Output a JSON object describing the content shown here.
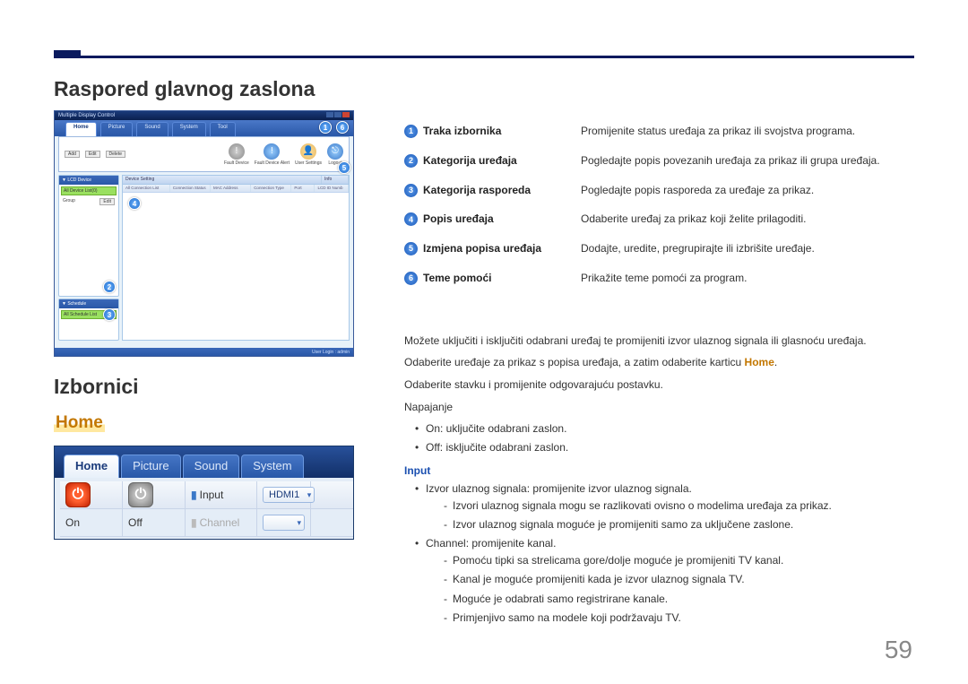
{
  "page_number": "59",
  "headings": {
    "layout": "Raspored glavnog zaslona",
    "menus": "Izbornici",
    "home": "Home"
  },
  "legend": {
    "items": [
      {
        "n": "1",
        "term": "Traka izbornika",
        "desc": "Promijenite status uređaja za prikaz ili svojstva programa."
      },
      {
        "n": "2",
        "term": "Kategorija uređaja",
        "desc": "Pogledajte popis povezanih uređaja za prikaz ili grupa uređaja."
      },
      {
        "n": "3",
        "term": "Kategorija rasporeda",
        "desc": "Pogledajte popis rasporeda za uređaje za prikaz."
      },
      {
        "n": "4",
        "term": "Popis uređaja",
        "desc": "Odaberite uređaj za prikaz koji želite prilagoditi."
      },
      {
        "n": "5",
        "term": "Izmjena popisa uređaja",
        "desc": "Dodajte, uredite, pregrupirajte ili izbrišite uređaje."
      },
      {
        "n": "6",
        "term": "Teme pomoći",
        "desc": "Prikažite teme pomoći za program."
      }
    ]
  },
  "shot1": {
    "title": "Multiple Display Control",
    "menutabs": [
      "Home",
      "Picture",
      "Sound",
      "System",
      "Tool"
    ],
    "toolbar_btns": [
      "Add",
      "Edit",
      "Delete"
    ],
    "toolbar_icons": [
      {
        "label": "Fault Device",
        "icon": "⚠"
      },
      {
        "label": "Fault Device Alert",
        "icon": "⚠"
      },
      {
        "label": "User Settings",
        "icon": "👤"
      },
      {
        "label": "Logout",
        "icon": "⎋"
      }
    ],
    "side_panel1_head": "▼ LCD Device",
    "side_panel1_item": "All Device List(0)",
    "side_panel1_group": "Group",
    "side_panel1_edit": "Edit",
    "side_panel2_head": "▼ Schedule",
    "side_panel2_item": "All Schedule List",
    "grid_cols_top": [
      "Device Setting",
      "Info"
    ],
    "grid_cols": [
      "All Connection List",
      "Connection Status",
      "MAC Address",
      "Connection Type",
      "Port",
      "LCD ID Numb"
    ],
    "status": "User Login : admin"
  },
  "shot2": {
    "tabs": [
      "Home",
      "Picture",
      "Sound",
      "System"
    ],
    "labels": {
      "on": "On",
      "off": "Off",
      "input": "Input",
      "channel": "Channel"
    },
    "dd_value": "HDMI1"
  },
  "right_text": {
    "p1": "Možete uključiti i isključiti odabrani uređaj te promijeniti izvor ulaznog signala ili glasnoću uređaja.",
    "p2_a": "Odaberite uređaje za prikaz s popisa uređaja, a zatim odaberite karticu ",
    "p2_hl": "Home",
    "p2_b": ".",
    "p3": "Odaberite stavku i promijenite odgovarajuću postavku.",
    "p4": "Napajanje",
    "bul1_a": "On",
    "bul1_b": ": uključite odabrani zaslon.",
    "bul2_a": "Off",
    "bul2_b": ": isključite odabrani zaslon.",
    "label_input": "Input",
    "bul3": "Izvor ulaznog signala: promijenite izvor ulaznog signala.",
    "dash3a": "Izvori ulaznog signala mogu se razlikovati ovisno o modelima uređaja za prikaz.",
    "dash3b": "Izvor ulaznog signala moguće je promijeniti samo za uključene zaslone.",
    "bul4_a": "Channel",
    "bul4_b": ": promijenite kanal.",
    "dash4a": "Pomoću tipki sa strelicama gore/dolje moguće je promijeniti TV kanal.",
    "dash4b_a": "Kanal je moguće promijeniti kada je izvor ulaznog signala ",
    "dash4b_hl": "TV",
    "dash4b_b": ".",
    "dash4c": "Moguće je odabrati samo registrirane kanale.",
    "dash4d": "Primjenjivo samo na modele koji podržavaju TV."
  }
}
